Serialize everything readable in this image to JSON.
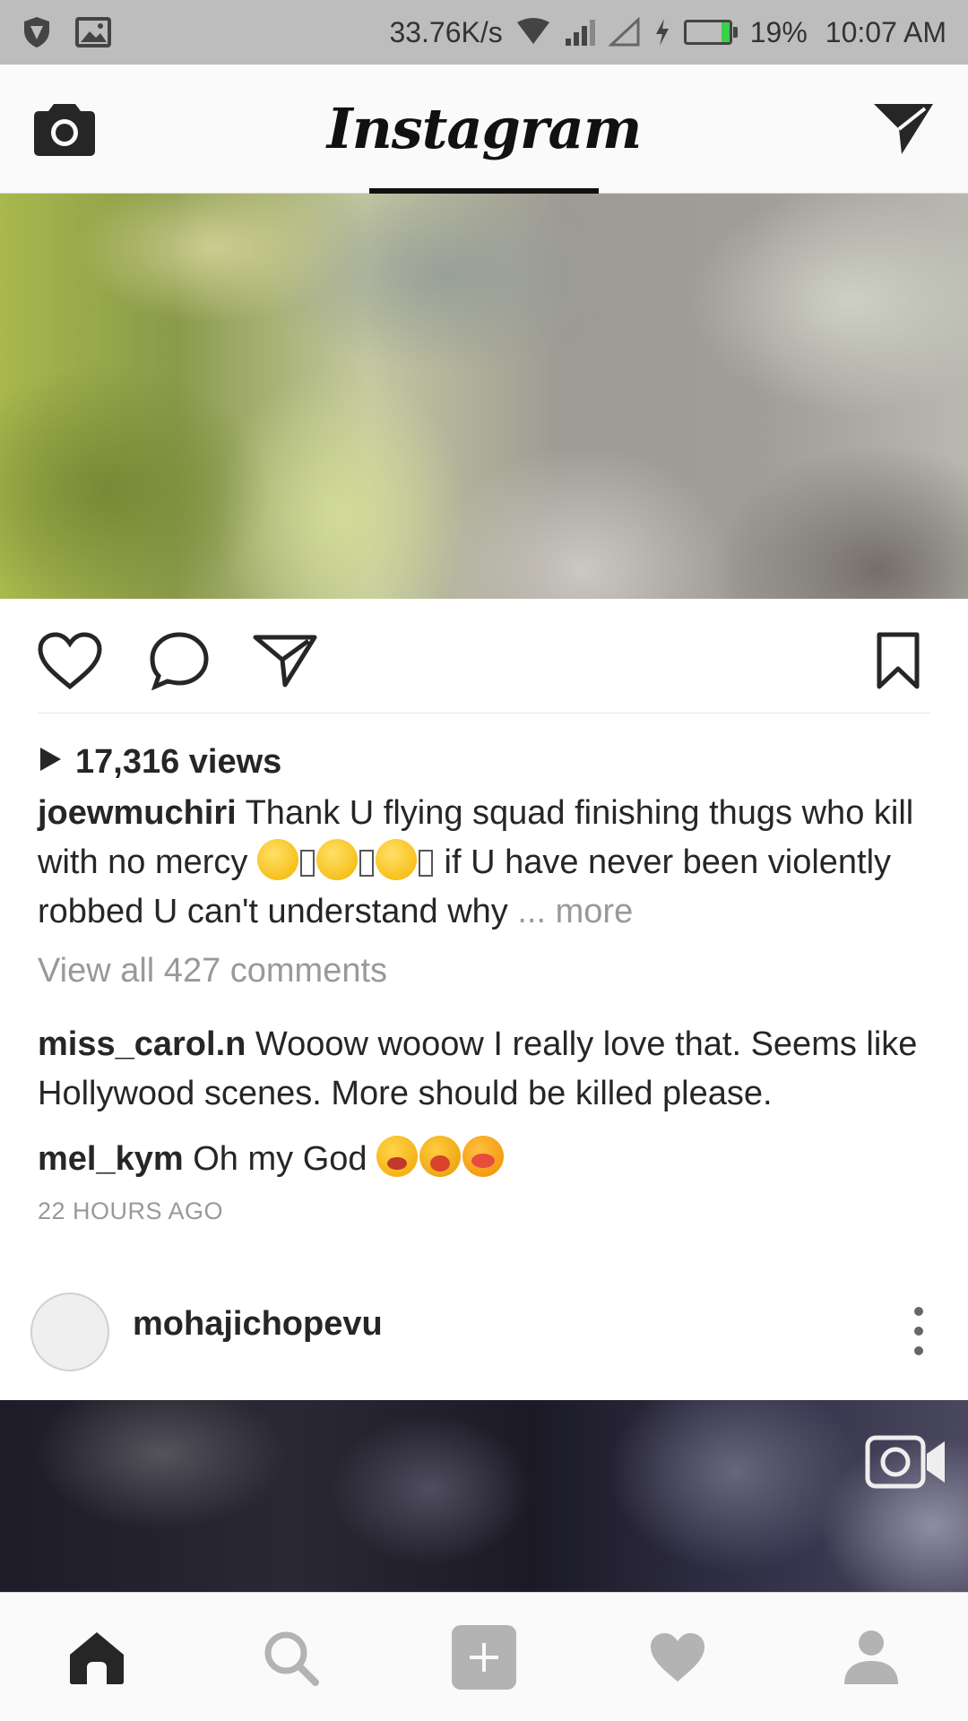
{
  "status_bar": {
    "speed": "33.76K/s",
    "battery_percent": "19%",
    "battery_level": 0.19,
    "time": "10:07 AM",
    "icons": [
      "shield-icon",
      "image-icon",
      "wifi-icon",
      "signal-icon",
      "signal-empty-icon",
      "charging-icon",
      "battery-icon"
    ]
  },
  "header": {
    "logo": "Instagram",
    "left_icon": "camera-icon",
    "right_icon": "direct-message-icon"
  },
  "post": {
    "actions": [
      "heart-icon",
      "comment-icon",
      "share-icon",
      "bookmark-icon"
    ],
    "views": "17,316 views",
    "caption": {
      "username": "joewmuchiri",
      "text_1": "Thank U flying squad finishing thugs who kill with no mercy",
      "text_2": "if U have never been violently robbed U can't understand why",
      "ellipsis": "...",
      "more": "more"
    },
    "view_all": "View all 427 comments",
    "comments": [
      {
        "username": "miss_carol.n",
        "text": "Wooow wooow I really love that. Seems like Hollywood scenes.  More should be killed please."
      },
      {
        "username": "mel_kym",
        "text": "Oh my God"
      }
    ],
    "timestamp": "22 HOURS AGO"
  },
  "next_post": {
    "username": "mohajichopevu",
    "menu_icon": "more-vertical-icon",
    "media_badge": "video-camera-icon"
  },
  "bottom_nav": {
    "items": [
      "home-icon",
      "search-icon",
      "add-post-icon",
      "activity-heart-icon",
      "profile-icon"
    ],
    "active": "home-icon"
  },
  "colors": {
    "text": "#262626",
    "muted": "#999999",
    "status_bar_bg": "#bdbdbd",
    "battery_green": "#3ad14a",
    "nav_inactive": "#b3b3b3"
  }
}
